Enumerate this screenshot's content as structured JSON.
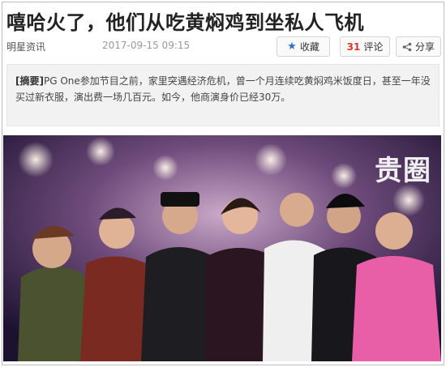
{
  "article": {
    "title": "嘻哈火了，他们从吃黄焖鸡到坐私人飞机",
    "source": "明星资讯",
    "date": "2017-09-15 09:15"
  },
  "actions": {
    "favorite_label": "收藏",
    "favorite_icon": "star-icon",
    "comment_count": "31",
    "comment_label": "评论",
    "share_label": "分享",
    "share_icon": "share-icon"
  },
  "summary": {
    "tag": "[摘要]",
    "text": "PG One参加节目之前，家里突遇经济危机，曾一个月连续吃黄焖鸡米饭度日，甚至一年没买过新衣服，演出费一场几百元。如今，他商演身价已经30万。"
  },
  "photo": {
    "watermark": "贵圈"
  },
  "colors": {
    "accent_blue": "#2f6fcf",
    "comment_red": "#d9372a",
    "summary_bg": "#f2f2f2"
  }
}
